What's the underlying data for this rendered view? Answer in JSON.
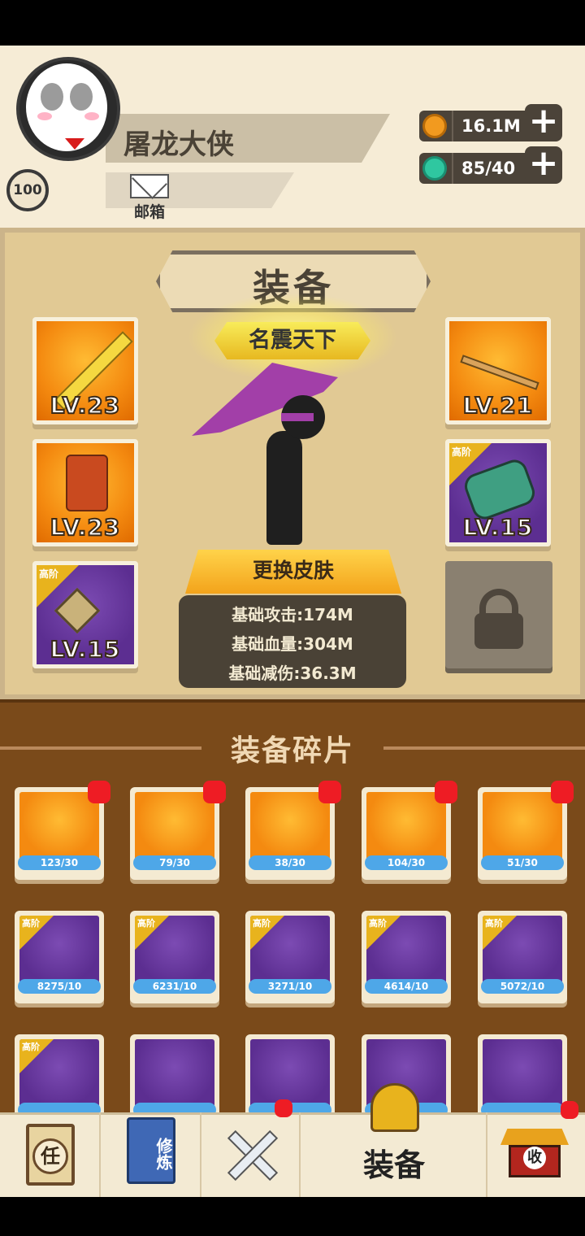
{
  "player": {
    "name": "屠龙大侠",
    "level": "100",
    "mail_label": "邮箱"
  },
  "resources": {
    "gold": "16.1M",
    "energy": "85/40"
  },
  "equipment": {
    "title": "装备",
    "rank_title": "名震天下",
    "change_skin_label": "更换皮肤",
    "slots": [
      {
        "level": "LV.23",
        "rarity": "orange",
        "item": "golden-sword"
      },
      {
        "level": "LV.23",
        "rarity": "orange",
        "item": "red-armor"
      },
      {
        "level": "LV.15",
        "rarity": "purple",
        "tier": "高阶",
        "item": "pendant-necklace"
      },
      {
        "level": "LV.21",
        "rarity": "orange",
        "item": "key-staff"
      },
      {
        "level": "LV.15",
        "rarity": "purple",
        "tier": "高阶",
        "item": "green-bracer"
      }
    ],
    "stats": [
      "基础攻击:174M",
      "基础血量:304M",
      "基础减伤:36.3M"
    ]
  },
  "fragments": {
    "title": "装备碎片",
    "items": [
      {
        "count": "123/30",
        "rarity": "orange",
        "badge": true
      },
      {
        "count": "79/30",
        "rarity": "orange",
        "badge": true
      },
      {
        "count": "38/30",
        "rarity": "orange",
        "badge": true
      },
      {
        "count": "104/30",
        "rarity": "orange",
        "badge": true
      },
      {
        "count": "51/30",
        "rarity": "orange",
        "badge": true
      },
      {
        "count": "8275/10",
        "rarity": "purple",
        "tier": "高阶"
      },
      {
        "count": "6231/10",
        "rarity": "purple",
        "tier": "高阶"
      },
      {
        "count": "3271/10",
        "rarity": "purple",
        "tier": "高阶"
      },
      {
        "count": "4614/10",
        "rarity": "purple",
        "tier": "高阶"
      },
      {
        "count": "5072/10",
        "rarity": "purple",
        "tier": "高阶"
      },
      {
        "count": "",
        "rarity": "purple",
        "tier": "高阶"
      },
      {
        "count": "",
        "rarity": "purple"
      },
      {
        "count": "",
        "rarity": "purple"
      },
      {
        "count": "",
        "rarity": "purple"
      },
      {
        "count": "",
        "rarity": "purple"
      }
    ]
  },
  "nav": {
    "task": "任",
    "cultivate": "修炼",
    "equip": "装备",
    "collect": "收"
  },
  "colors": {
    "orange_bg": "#f48a10",
    "purple_bg": "#5c2e91",
    "badge_red": "#ee1c24",
    "panel_tan": "#e1c994",
    "fragment_brown": "#7a4a1a"
  }
}
